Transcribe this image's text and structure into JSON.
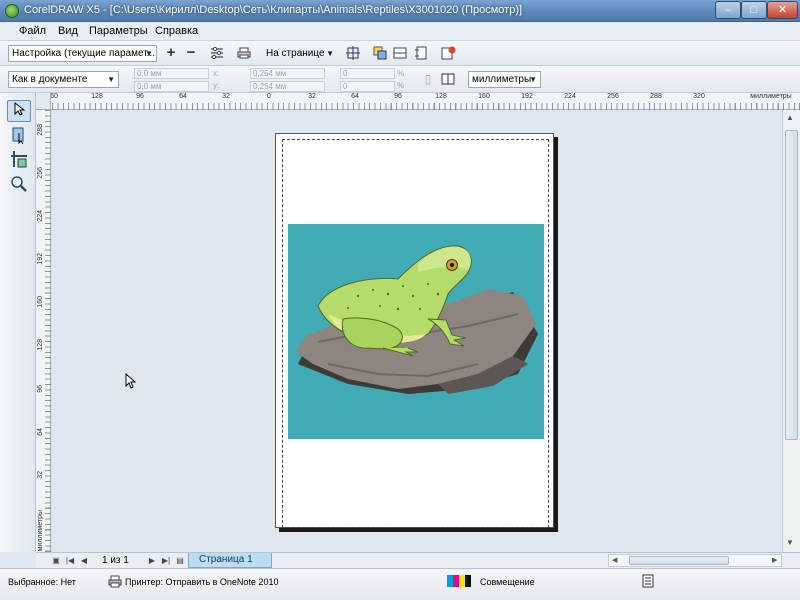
{
  "window": {
    "title": "CorelDRAW X5 - [C:\\Users\\Кирилл\\Desktop\\Сеть\\Клипарты\\Animals\\Reptiles\\X3001020 (Просмотр)]",
    "minimize_glyph": "–",
    "maximize_glyph": "□",
    "close_glyph": "✕"
  },
  "menu": {
    "items": [
      {
        "label": "Файл"
      },
      {
        "label": "Вид"
      },
      {
        "label": "Параметры"
      },
      {
        "label": "Справка"
      }
    ]
  },
  "toolbar1": {
    "preset_value": "Настройка (текущие парамет...",
    "add_icon": "plus-icon",
    "remove_icon": "minus-icon",
    "fit_mode_value": "На странице"
  },
  "toolbar2": {
    "location_value": "Как в документе",
    "x_label": "x:",
    "y_label": "y:",
    "field_x1": "0,0 мм",
    "field_x2": "0,0 мм",
    "field_w1": "0,254 мм",
    "field_w2": "0,254 мм",
    "field_p1": "0",
    "field_p2": "0",
    "percent": "%",
    "units_value": "миллиметры"
  },
  "rulers": {
    "top_ticks": [
      "60",
      "128",
      "96",
      "64",
      "32",
      "0",
      "32",
      "64",
      "96",
      "128",
      "160",
      "192",
      "224",
      "256",
      "288",
      "320"
    ],
    "top_unit": "миллиметры",
    "left_ticks": [
      "288",
      "256",
      "224",
      "192",
      "160",
      "128",
      "96",
      "64",
      "32"
    ],
    "left_unit": "миллиметры"
  },
  "page_nav": {
    "count": "1 из 1",
    "tab_label": "Страница 1"
  },
  "status": {
    "selection": "Выбранное: Нет",
    "printer": "Принтер: Отправить в OneNote 2010",
    "overprint": "Совмещение"
  },
  "colors": {
    "artwork_background": "#42aab4",
    "frog_body": "#b5dc6a",
    "rock": "#8c8580"
  }
}
